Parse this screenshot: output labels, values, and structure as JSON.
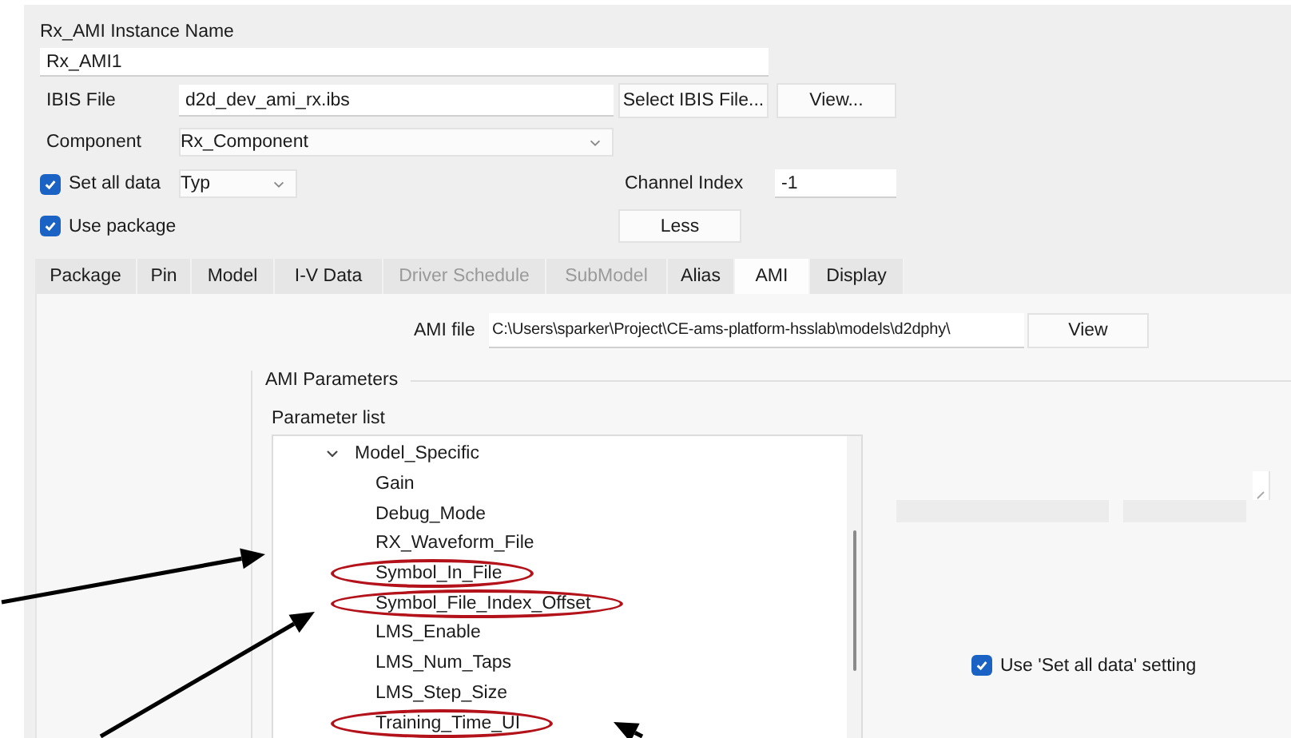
{
  "instance_name": {
    "label": "Rx_AMI Instance Name",
    "value": "Rx_AMI1"
  },
  "ibis_file": {
    "label": "IBIS File",
    "value": "d2d_dev_ami_rx.ibs",
    "buttons": [
      "Select IBIS File...",
      "View..."
    ]
  },
  "component": {
    "label": "Component",
    "value": "Rx_Component"
  },
  "set_all_data": {
    "label": "Set all data",
    "checked": true,
    "value": "Typ"
  },
  "channel_index": {
    "label": "Channel Index",
    "value": "-1"
  },
  "use_package": {
    "label": "Use package",
    "checked": true
  },
  "less_button": "Less",
  "tabs": [
    {
      "label": "Package",
      "selected": false,
      "disabled": false
    },
    {
      "label": "Pin",
      "selected": false,
      "disabled": false
    },
    {
      "label": "Model",
      "selected": false,
      "disabled": false
    },
    {
      "label": "I-V Data",
      "selected": false,
      "disabled": false
    },
    {
      "label": "Driver Schedule",
      "selected": false,
      "disabled": true
    },
    {
      "label": "SubModel",
      "selected": false,
      "disabled": true
    },
    {
      "label": "Alias",
      "selected": false,
      "disabled": false
    },
    {
      "label": "AMI",
      "selected": true,
      "disabled": false
    },
    {
      "label": "Display",
      "selected": false,
      "disabled": false
    }
  ],
  "ami_file": {
    "label": "AMI file",
    "value": "C:\\Users\\sparker\\Project\\CE-ams-platform-hsslab\\models\\d2dphy\\",
    "button": "View"
  },
  "ami_parameters": {
    "title": "AMI Parameters",
    "list_label": "Parameter list",
    "tree": [
      {
        "label": "Model_Specific",
        "expanded": true,
        "circled": false,
        "children": [
          {
            "label": "Gain",
            "circled": false
          },
          {
            "label": "Debug_Mode",
            "circled": false
          },
          {
            "label": "RX_Waveform_File",
            "circled": false
          },
          {
            "label": "Symbol_In_File",
            "circled": true
          },
          {
            "label": "Symbol_File_Index_Offset",
            "circled": true
          },
          {
            "label": "LMS_Enable",
            "circled": false
          },
          {
            "label": "LMS_Num_Taps",
            "circled": false
          },
          {
            "label": "LMS_Step_Size",
            "circled": false
          },
          {
            "label": "Training_Time_UI",
            "circled": true
          }
        ]
      }
    ]
  },
  "use_set_all_data": {
    "label": "Use 'Set all data' setting",
    "checked": true
  }
}
